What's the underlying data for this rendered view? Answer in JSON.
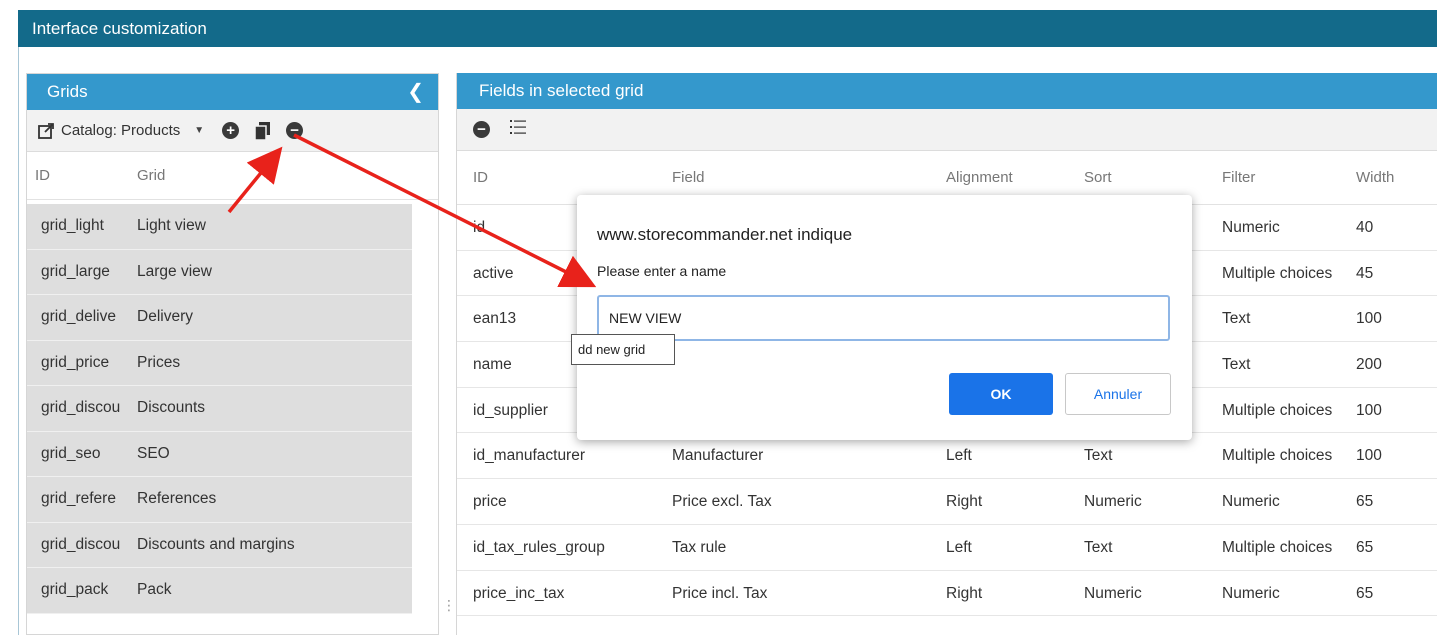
{
  "window": {
    "title": "Interface customization"
  },
  "grids_panel": {
    "title": "Grids",
    "collapse_icon": "chevron-left-icon",
    "toolbar": {
      "catalog_label": "Catalog: Products",
      "icons": [
        "external-link-icon",
        "chevron-down-icon",
        "add-circle-icon",
        "copy-icon",
        "remove-circle-icon"
      ]
    },
    "columns": [
      "ID",
      "Grid"
    ],
    "rows": [
      {
        "id": "grid_light",
        "name": "Light view"
      },
      {
        "id": "grid_large",
        "name": "Large view"
      },
      {
        "id": "grid_delive",
        "name": "Delivery"
      },
      {
        "id": "grid_price",
        "name": "Prices"
      },
      {
        "id": "grid_discou",
        "name": "Discounts"
      },
      {
        "id": "grid_seo",
        "name": "SEO"
      },
      {
        "id": "grid_refere",
        "name": "References"
      },
      {
        "id": "grid_discou",
        "name": "Discounts and margins"
      },
      {
        "id": "grid_pack",
        "name": "Pack"
      }
    ]
  },
  "fields_panel": {
    "title": "Fields in selected grid",
    "toolbar_icons": [
      "remove-circle-icon",
      "list-icon"
    ],
    "columns": [
      "ID",
      "Field",
      "Alignment",
      "Sort",
      "Filter",
      "Width"
    ],
    "rows": [
      {
        "id": "id",
        "field": "",
        "alignment": "",
        "sort": "",
        "filter": "Numeric",
        "width": "40"
      },
      {
        "id": "active",
        "field": "",
        "alignment": "",
        "sort": "",
        "filter": "Multiple choices",
        "width": "45"
      },
      {
        "id": "ean13",
        "field": "",
        "alignment": "",
        "sort": "",
        "filter": "Text",
        "width": "100"
      },
      {
        "id": "name",
        "field": "",
        "alignment": "",
        "sort": "",
        "filter": "Text",
        "width": "200"
      },
      {
        "id": "id_supplier",
        "field": "",
        "alignment": "",
        "sort": "",
        "filter": "Multiple choices",
        "width": "100"
      },
      {
        "id": "id_manufacturer",
        "field": "Manufacturer",
        "alignment": "Left",
        "sort": "Text",
        "filter": "Multiple choices",
        "width": "100"
      },
      {
        "id": "price",
        "field": "Price excl. Tax",
        "alignment": "Right",
        "sort": "Numeric",
        "filter": "Numeric",
        "width": "65"
      },
      {
        "id": "id_tax_rules_group",
        "field": "Tax rule",
        "alignment": "Left",
        "sort": "Text",
        "filter": "Multiple choices",
        "width": "65"
      },
      {
        "id": "price_inc_tax",
        "field": "Price incl. Tax",
        "alignment": "Right",
        "sort": "Numeric",
        "filter": "Numeric",
        "width": "65"
      }
    ]
  },
  "dialog": {
    "title": "www.storecommander.net indique",
    "message": "Please enter a name",
    "input_value": "NEW VIEW",
    "ok_label": "OK",
    "cancel_label": "Annuler"
  },
  "tooltip": {
    "text": "dd new grid"
  },
  "colors": {
    "titlebar": "#136a8a",
    "panel_header": "#3498cc",
    "ok_button": "#1a73e8",
    "annotation_arrow": "#e8221b"
  }
}
